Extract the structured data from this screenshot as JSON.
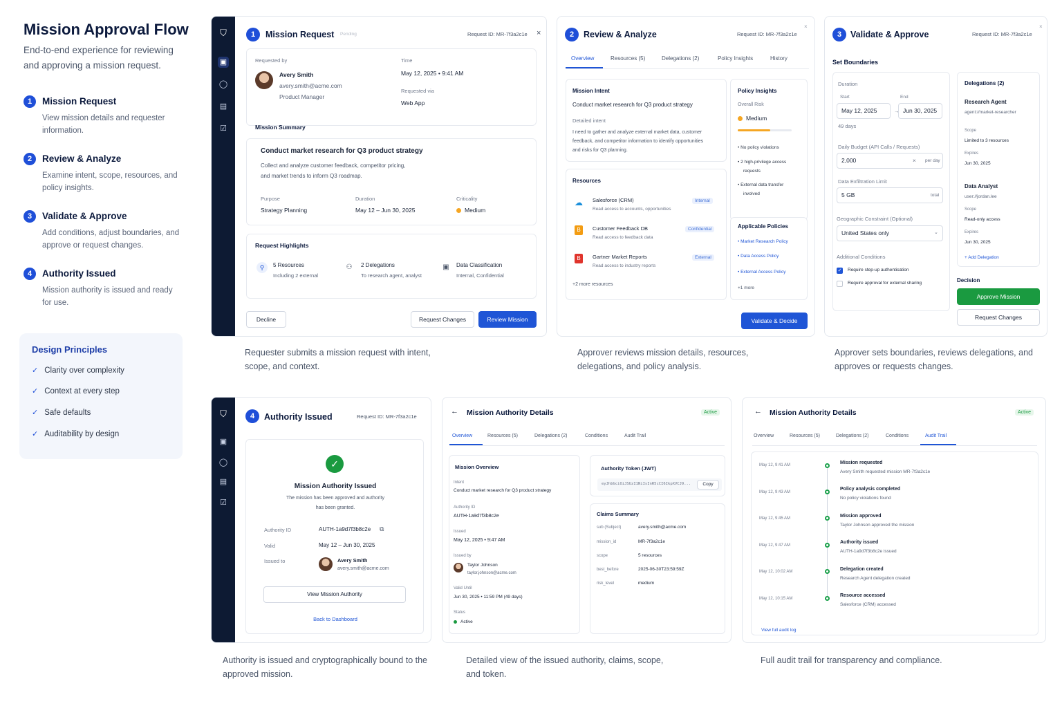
{
  "left": {
    "title": "Mission Approval Flow",
    "subtitle": "End-to-end experience for reviewing and approving a mission request.",
    "steps": [
      {
        "num": "1",
        "title": "Mission Request",
        "desc": "View mission details and requester information."
      },
      {
        "num": "2",
        "title": "Review & Analyze",
        "desc": "Examine intent, scope, resources, and policy insights."
      },
      {
        "num": "3",
        "title": "Validate & Approve",
        "desc": "Add conditions, adjust boundaries, and approve or request changes."
      },
      {
        "num": "4",
        "title": "Authority Issued",
        "desc": "Mission authority is issued and ready for use."
      }
    ],
    "principles": {
      "title": "Design Principles",
      "items": [
        "Clarity over complexity",
        "Context at every step",
        "Safe defaults",
        "Auditability by design"
      ]
    }
  },
  "colors": {
    "accent": "#1f55d6",
    "sidebar": "#0d1a33",
    "success": "#1a9a40",
    "warning": "#f5a623"
  },
  "card1": {
    "num": "1",
    "title": "Mission Request",
    "status": "Pending",
    "request_id": "Request ID:  MR-7f3a2c1e",
    "close": "×",
    "requested_by_label": "Requested by",
    "name": "Avery Smith",
    "email": "avery.smith@acme.com",
    "role": "Product Manager",
    "time_label": "Time",
    "time": "May 12, 2025 • 9:41 AM",
    "via_label": "Requested via",
    "via": "Web App",
    "summary_label": "Mission Summary",
    "summary_title": "Conduct market research for Q3 product strategy",
    "summary_desc1": "Collect and analyze customer feedback, competitor pricing,",
    "summary_desc2": "and market trends to inform Q3 roadmap.",
    "purpose_label": "Purpose",
    "purpose": "Strategy Planning",
    "duration_label": "Duration",
    "duration": "May 12 – Jun 30, 2025",
    "criticality_label": "Criticality",
    "criticality": "Medium",
    "highlights_label": "Request Highlights",
    "h1_title": "5 Resources",
    "h1_sub": "Including 2 external",
    "h2_title": "2 Delegations",
    "h2_sub": "To research agent, analyst",
    "h3_title": "Data Classification",
    "h3_sub": "Internal, Confidential",
    "decline": "Decline",
    "request_changes": "Request Changes",
    "review": "Review Mission",
    "caption": "Requester submits a mission request with intent, scope, and context."
  },
  "card2": {
    "num": "2",
    "title": "Review & Analyze",
    "request_id": "Request ID:  MR-7f3a2c1e",
    "close": "×",
    "tabs": [
      "Overview",
      "Resources (5)",
      "Delegations (2)",
      "Policy Insights",
      "History"
    ],
    "intent_label": "Mission Intent",
    "intent": "Conduct market research for Q3 product strategy",
    "detailed_label": "Detailed intent",
    "detailed1": "I need to gather and analyze external market data, customer",
    "detailed2": "feedback, and competitor information to identify opportunities",
    "detailed3": "and risks for Q3 planning.",
    "resources_label": "Resources",
    "resources": [
      {
        "name": "Salesforce (CRM)",
        "desc": "Read access to accounts, opportunities",
        "tag": "Internal"
      },
      {
        "name": "Customer Feedback DB",
        "desc": "Read access to feedback data",
        "tag": "Confidential"
      },
      {
        "name": "Gartner Market Reports",
        "desc": "Read access to industry reports",
        "tag": "External"
      }
    ],
    "more_resources": "+2 more resources",
    "insights_label": "Policy Insights",
    "risk_label": "Overall Risk",
    "risk": "Medium",
    "insight1": "No policy violations",
    "insight2a": "2 high-privilege access",
    "insight2b": "requests",
    "insight3a": "External data transfer",
    "insight3b": "involved",
    "policies_label": "Applicable Policies",
    "policies": [
      "Market Research Policy",
      "Data Access Policy",
      "External Access Policy"
    ],
    "more_policies": "+1 more",
    "validate": "Validate & Decide",
    "caption": "Approver reviews mission details, resources, delegations, and policy analysis."
  },
  "card3": {
    "num": "3",
    "title": "Validate & Approve",
    "request_id": "Request ID:  MR-7f3a2c1e",
    "close": "×",
    "boundaries_label": "Set Boundaries",
    "duration_label": "Duration",
    "start_label": "Start",
    "end_label": "End",
    "start": "May 12, 2025",
    "end": "Jun 30, 2025",
    "days": "49 days",
    "budget_label": "Daily Budget (API Calls / Requests)",
    "budget": "2,000",
    "per_day": "per day",
    "exfil_label": "Data Exfiltration Limit",
    "exfil": "5 GB",
    "total": "total",
    "geo_label": "Geographic Constraint (Optional)",
    "geo": "United States only",
    "conditions_label": "Additional Conditions",
    "cond1": "Require step-up authentication",
    "cond2": "Require approval for external sharing",
    "delegations_label": "Delegations (2)",
    "d1_name": "Research Agent",
    "d1_id": "agent://market-researcher",
    "scope_label": "Scope",
    "d1_scope": "Limited to 3 resources",
    "expires_label": "Expires",
    "d1_expires": "Jun 30, 2025",
    "d2_name": "Data Analyst",
    "d2_id": "user://jordan.lee",
    "d2_scope": "Read-only access",
    "d2_expires": "Jun 30, 2025",
    "add_delegation": "+ Add Delegation",
    "decision_label": "Decision",
    "approve": "Approve Mission",
    "request_changes": "Request Changes",
    "caption": "Approver sets boundaries, reviews delegations, and approves or requests changes."
  },
  "card4": {
    "num": "4",
    "title": "Authority Issued",
    "request_id": "Request ID:  MR-7f3a2c1e",
    "issued_title": "Mission Authority Issued",
    "issued_desc1": "The mission has been approved and authority",
    "issued_desc2": "has been granted.",
    "id_label": "Authority ID",
    "id": "AUTH-1a9d7f3b8c2e",
    "valid_label": "Valid",
    "valid": "May 12 – Jun 30, 2025",
    "issued_to_label": "Issued to",
    "name": "Avery Smith",
    "email": "avery.smith@acme.com",
    "view": "View Mission Authority",
    "back": "Back to Dashboard",
    "caption": "Authority is issued and cryptographically bound to the approved mission."
  },
  "card5": {
    "title": "Mission Authority Details",
    "status": "Active",
    "back": "←",
    "tabs": [
      "Overview",
      "Resources (5)",
      "Delegations (2)",
      "Conditions",
      "Audit Trail"
    ],
    "overview_label": "Mission Overview",
    "intent_label": "Intent",
    "intent": "Conduct market research for Q3 product strategy",
    "id_label": "Authority ID",
    "id": "AUTH-1a9d7f3b8c2e",
    "issued_label": "Issued",
    "issued": "May 12, 2025 • 9:47 AM",
    "issuer_label": "Issued by",
    "issuer_name": "Taylor Johnson",
    "issuer_email": "taylor.johnson@acme.com",
    "valid_label": "Valid Until",
    "valid": "Jun 30, 2025 • 11:59 PM (49 days)",
    "status_label": "Status",
    "status_val": "Active",
    "token_label": "Authority Token (JWT)",
    "token": "eyJhbGciOiJSUzI1NiIsInR5cCI6IkpXVCJ9...",
    "copy": "Copy",
    "claims_label": "Claims Summary",
    "claims": [
      {
        "k": "sub (Subject)",
        "v": "avery.smith@acme.com"
      },
      {
        "k": "mission_id",
        "v": "MR-7f3a2c1e"
      },
      {
        "k": "scope",
        "v": "5 resources"
      },
      {
        "k": "best_before",
        "v": "2025-06-30T23:59:59Z"
      },
      {
        "k": "risk_level",
        "v": "medium"
      }
    ],
    "caption": "Detailed view of the issued authority, claims, scope, and token."
  },
  "card6": {
    "title": "Mission Authority Details",
    "status": "Active",
    "back": "←",
    "tabs": [
      "Overview",
      "Resources (5)",
      "Delegations (2)",
      "Conditions",
      "Audit Trail"
    ],
    "events": [
      {
        "time": "May 12,  9:41 AM",
        "title": "Mission requested",
        "desc": "Avery Smith requested mission MR-7f3a2c1e"
      },
      {
        "time": "May 12,  9:43 AM",
        "title": "Policy analysis completed",
        "desc": "No policy violations found"
      },
      {
        "time": "May 12,  9:45 AM",
        "title": "Mission approved",
        "desc": "Taylor Johnson approved the mission"
      },
      {
        "time": "May 12,  9:47 AM",
        "title": "Authority issued",
        "desc": "AUTH-1a9d7f3b8c2e issued"
      },
      {
        "time": "May 12,  10:02 AM",
        "title": "Delegation created",
        "desc": "Research Agent delegation created"
      },
      {
        "time": "May 12,  10:15 AM",
        "title": "Resource accessed",
        "desc": "Salesforce (CRM) accessed"
      }
    ],
    "view_log": "View full audit log",
    "caption": "Full audit trail for transparency and compliance."
  }
}
